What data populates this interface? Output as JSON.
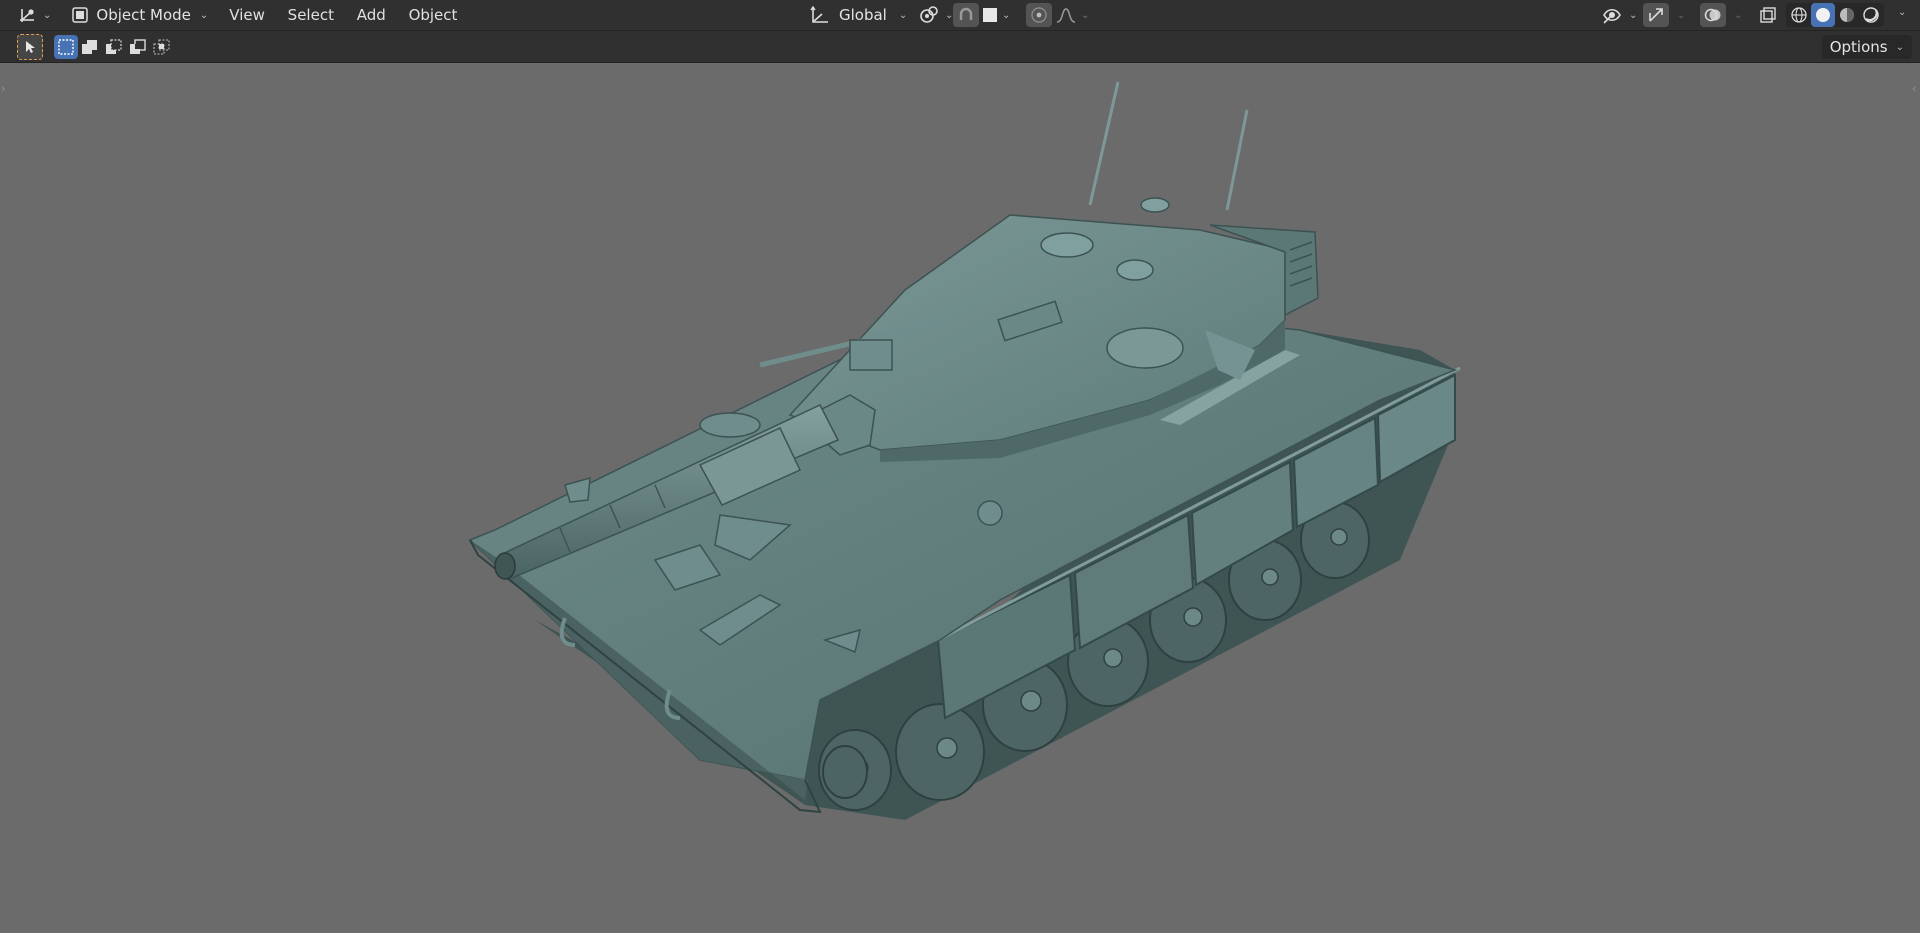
{
  "header": {
    "editor_type_icon": "viewport-axes-icon",
    "mode_label": "Object Mode",
    "menus": [
      "View",
      "Select",
      "Add",
      "Object"
    ],
    "transform_orientation": "Global"
  },
  "toolbar": {
    "tool_icon": "select-box-icon",
    "select_modes": [
      "set-new-selection-icon",
      "extend-selection-icon",
      "subtract-selection-icon",
      "invert-selection-icon",
      "intersect-selection-icon"
    ],
    "options_label": "Options"
  },
  "colors": {
    "header_bg": "#303030",
    "viewport_bg": "#6b6b6b",
    "accent": "#4772b3",
    "model": "#5a7776"
  }
}
